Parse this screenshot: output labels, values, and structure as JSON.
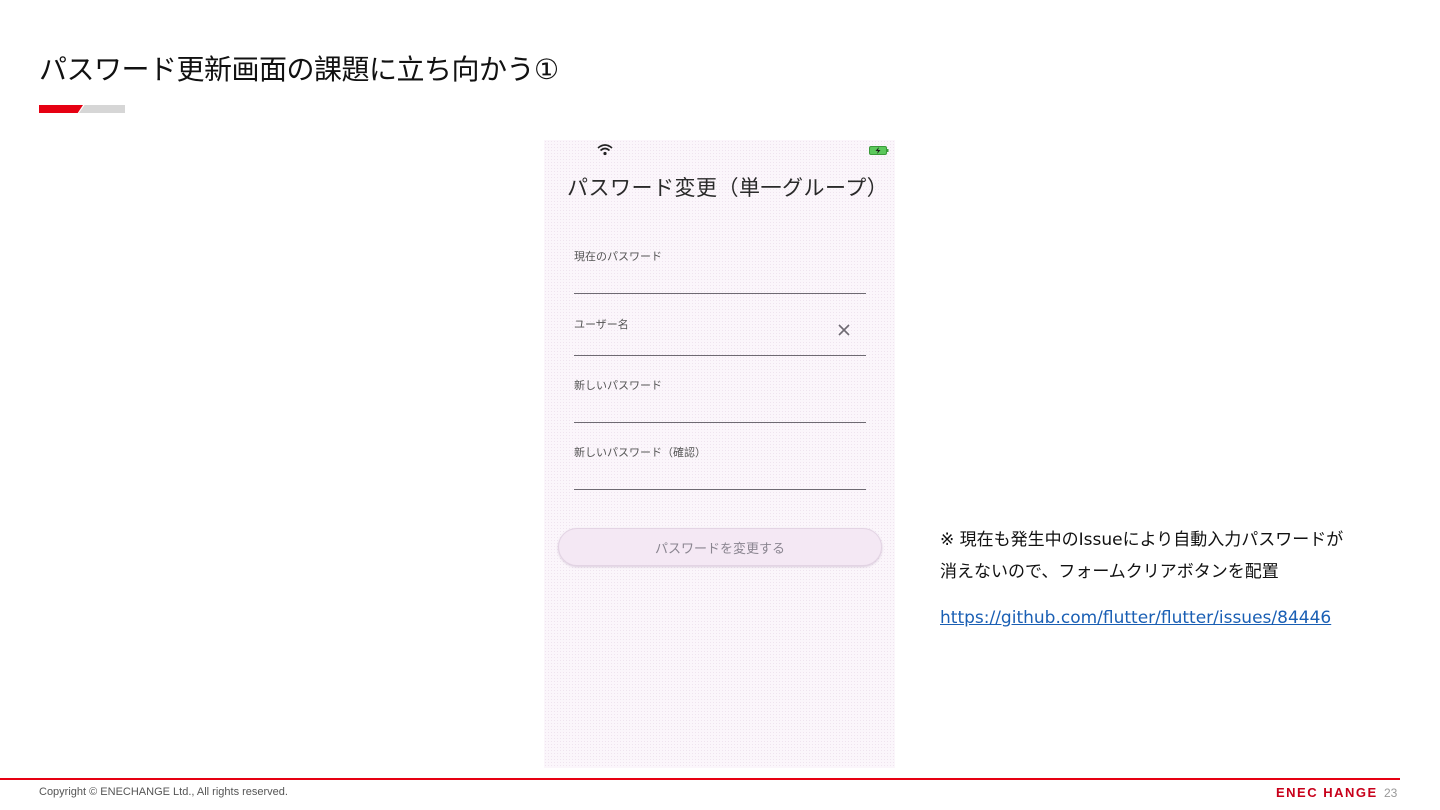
{
  "slide": {
    "title": "パスワード更新画面の課題に立ち向かう①",
    "accent_color": "#e60012"
  },
  "phone": {
    "screen_title": "パスワード変更（単一グループ）",
    "status_icons": [
      "wifi-icon",
      "battery-charging-icon"
    ],
    "fields": [
      {
        "label": "現在のパスワード",
        "value": ""
      },
      {
        "label": "ユーザー名",
        "value": "",
        "trailing_icon": "close-icon"
      },
      {
        "label": "新しいパスワード",
        "value": ""
      },
      {
        "label": "新しいパスワード（確認）",
        "value": ""
      }
    ],
    "submit_label": "パスワードを変更する"
  },
  "note": {
    "line1": "※ 現在も発生中のIssueにより自動入力パスワードが",
    "line2": "消えないので、フォームクリアボタンを配置",
    "link_text": "https://github.com/flutter/flutter/issues/84446"
  },
  "footer": {
    "copyright": "Copyright © ENECHANGE Ltd., All rights reserved.",
    "brand": "ENEC HANGE",
    "page_number": "23"
  }
}
